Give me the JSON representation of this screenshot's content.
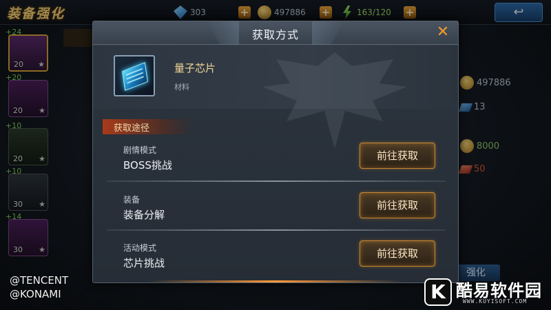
{
  "screen_title": "装备强化",
  "top_resources": [
    {
      "icon": "diamond-icon",
      "value": "303"
    },
    {
      "icon": "coin-icon",
      "value": "497886"
    },
    {
      "icon": "energy-icon",
      "value": "163/120"
    }
  ],
  "back_button": "↩",
  "side_items": [
    {
      "level": "+24",
      "count": "20"
    },
    {
      "level": "+20",
      "count": "20"
    },
    {
      "level": "+10",
      "count": "20"
    },
    {
      "level": "+10",
      "count": "30"
    },
    {
      "level": "+14",
      "count": "30"
    }
  ],
  "right_resources": [
    {
      "value": "497886"
    },
    {
      "value": "13"
    },
    {
      "value": "8000"
    },
    {
      "value": "50"
    }
  ],
  "background_hint": "强化",
  "modal": {
    "title": "获取方式",
    "close": "✕",
    "item": {
      "name": "量子芯片",
      "type": "材料"
    },
    "section_label": "获取途径",
    "routes": [
      {
        "category": "剧情模式",
        "name": "BOSS挑战",
        "button": "前往获取"
      },
      {
        "category": "装备",
        "name": "装备分解",
        "button": "前往获取"
      },
      {
        "category": "活动模式",
        "name": "芯片挑战",
        "button": "前往获取"
      }
    ]
  },
  "watermark": {
    "line1": "@TENCENT",
    "line2": "@KONAMI"
  },
  "site_logo": {
    "letter": "K",
    "name": "酷易软件园",
    "url": "WWW.KUYISOFT.COM"
  },
  "colors": {
    "accent_orange": "#f39a2b",
    "item_name": "#f3d79a",
    "button_border": "#c9892f"
  }
}
